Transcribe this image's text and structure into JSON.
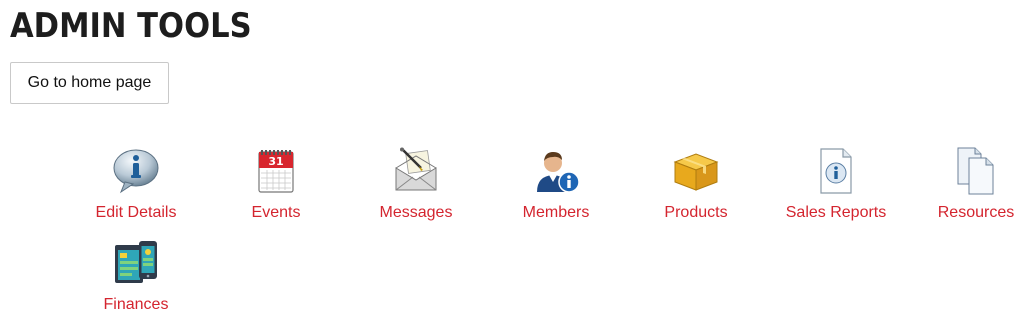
{
  "header": {
    "title": "ADMIN TOOLS"
  },
  "home_button": {
    "label": "Go to home page"
  },
  "tools": [
    {
      "label": "Edit Details",
      "icon": "info-bubble-icon"
    },
    {
      "label": "Events",
      "icon": "calendar-icon"
    },
    {
      "label": "Messages",
      "icon": "envelope-icon"
    },
    {
      "label": "Members",
      "icon": "user-info-icon"
    },
    {
      "label": "Products",
      "icon": "box-icon"
    },
    {
      "label": "Sales Reports",
      "icon": "report-info-icon"
    },
    {
      "label": "Resources",
      "icon": "documents-icon"
    },
    {
      "label": "Finances",
      "icon": "finance-devices-icon"
    }
  ],
  "calendar_day": "31",
  "colors": {
    "link": "#d4252f",
    "title": "#1d1d1d"
  }
}
